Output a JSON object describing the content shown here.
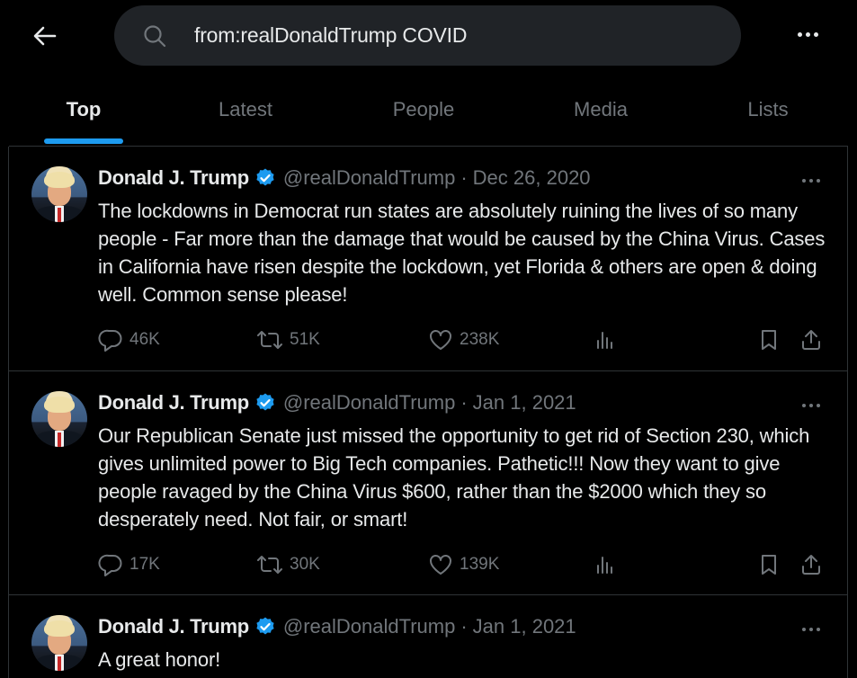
{
  "search": {
    "query": "from:realDonaldTrump COVID"
  },
  "tabs": [
    {
      "label": "Top"
    },
    {
      "label": "Latest"
    },
    {
      "label": "People"
    },
    {
      "label": "Media"
    },
    {
      "label": "Lists"
    }
  ],
  "accent_color": "#1d9bf0",
  "tweets": [
    {
      "name": "Donald J. Trump",
      "handle": "@realDonaldTrump",
      "separator": "·",
      "date": "Dec 26, 2020",
      "text": "The lockdowns in Democrat run states are absolutely ruining the lives of so many people - Far more than the damage that would be caused by the China Virus. Cases in California have risen despite the lockdown, yet Florida & others are open & doing well. Common sense please!",
      "replies": "46K",
      "reposts": "51K",
      "likes": "238K"
    },
    {
      "name": "Donald J. Trump",
      "handle": "@realDonaldTrump",
      "separator": "·",
      "date": "Jan 1, 2021",
      "text": "Our Republican Senate just missed the opportunity to get rid of Section 230, which gives unlimited power to Big Tech companies. Pathetic!!! Now they want to give people ravaged by the China Virus $600, rather than the $2000 which they so desperately need. Not fair, or smart!",
      "replies": "17K",
      "reposts": "30K",
      "likes": "139K"
    },
    {
      "name": "Donald J. Trump",
      "handle": "@realDonaldTrump",
      "separator": "·",
      "date": "Jan 1, 2021",
      "text": "A great honor!"
    }
  ]
}
